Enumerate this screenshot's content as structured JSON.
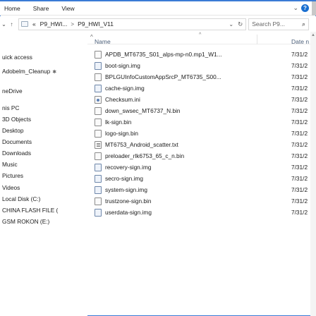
{
  "ribbon": {
    "tabs": [
      "Home",
      "Share",
      "View"
    ],
    "collapse_icon": "chevron-down-icon",
    "help_icon": "help-icon",
    "help_glyph": "?"
  },
  "address_bar": {
    "back": "←",
    "forward": "→",
    "up": "↑",
    "history": "⌄",
    "overflow": "«",
    "crumbs": [
      "P9_HWI...",
      "P9_HWI_V11"
    ],
    "separator": ">",
    "dropdown": "⌄",
    "refresh": "↻",
    "search_placeholder": "Search P9...",
    "search_icon": "⌕"
  },
  "nav_pane": {
    "items": [
      "uick access",
      "Adobelm_Cleanup",
      "neDrive",
      "nis PC",
      "3D Objects",
      "Desktop",
      "Documents",
      "Downloads",
      "Music",
      "Pictures",
      "Videos",
      "Local Disk (C:)",
      "CHINA FLASH FILE (",
      "GSM ROKON (E:)"
    ],
    "pin_glyph": "✱"
  },
  "columns": {
    "name": "Name",
    "date": "Date n",
    "sort_glyph": "^",
    "collapse_glyph": "^"
  },
  "files": [
    {
      "name": "APDB_MT6735_S01_alps-mp-n0.mp1_W1...",
      "date": "7/31/2",
      "icon": "file-icon"
    },
    {
      "name": "boot-sign.img",
      "date": "7/31/2",
      "icon": "disk-image-icon"
    },
    {
      "name": "BPLGUInfoCustomAppSrcP_MT6735_S00...",
      "date": "7/31/2",
      "icon": "file-icon"
    },
    {
      "name": "cache-sign.img",
      "date": "7/31/2",
      "icon": "disk-image-icon"
    },
    {
      "name": "Checksum.ini",
      "date": "7/31/2",
      "icon": "settings-file-icon"
    },
    {
      "name": "down_swsec_MT6737_N.bin",
      "date": "7/31/2",
      "icon": "file-icon"
    },
    {
      "name": "lk-sign.bin",
      "date": "7/31/2",
      "icon": "file-icon"
    },
    {
      "name": "logo-sign.bin",
      "date": "7/31/2",
      "icon": "file-icon"
    },
    {
      "name": "MT6753_Android_scatter.txt",
      "date": "7/31/2",
      "icon": "text-file-icon"
    },
    {
      "name": "preloader_rlk6753_65_c_n.bin",
      "date": "7/31/2",
      "icon": "file-icon"
    },
    {
      "name": "recovery-sign.img",
      "date": "7/31/2",
      "icon": "disk-image-icon"
    },
    {
      "name": "secro-sign.img",
      "date": "7/31/2",
      "icon": "disk-image-icon"
    },
    {
      "name": "system-sign.img",
      "date": "7/31/2",
      "icon": "disk-image-icon"
    },
    {
      "name": "trustzone-sign.bin",
      "date": "7/31/2",
      "icon": "file-icon"
    },
    {
      "name": "userdata-sign.img",
      "date": "7/31/2",
      "icon": "disk-image-icon"
    }
  ],
  "colors": {
    "accent": "#1a6fd0",
    "window_border": "#3a7bd5",
    "header_text": "#4c607a"
  }
}
